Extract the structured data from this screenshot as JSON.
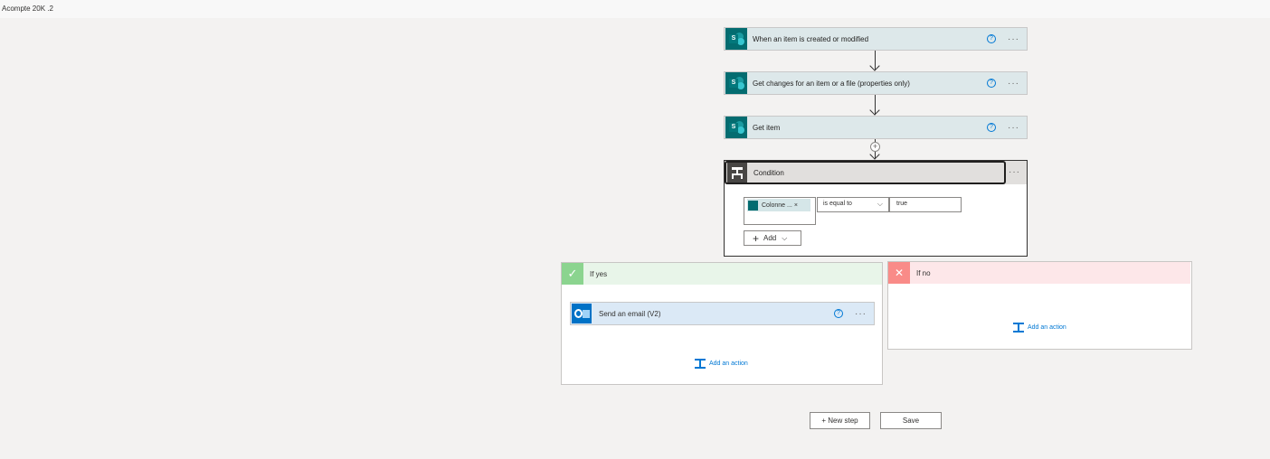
{
  "window": {
    "title": "Acompte 20K .2"
  },
  "steps": [
    {
      "title": "When an item is created or modified",
      "icon": "sharepoint-icon"
    },
    {
      "title": "Get changes for an item or a file (properties only)",
      "icon": "sharepoint-icon"
    },
    {
      "title": "Get item",
      "icon": "sharepoint-icon"
    }
  ],
  "icons": {
    "help": "?",
    "more": "···",
    "plus": "+",
    "check": "✓",
    "cross": "✕",
    "chevron": "⌵",
    "remove": "×",
    "sp_letter": "S"
  },
  "condition": {
    "title": "Condition",
    "token_label": "Colonne ...",
    "operator": "is equal to",
    "value": "true",
    "add_label": "Add"
  },
  "branches": {
    "yes": {
      "label": "If yes",
      "action_title": "Send an email (V2)",
      "add_action_label": "Add an action"
    },
    "no": {
      "label": "If no",
      "add_action_label": "Add an action"
    }
  },
  "footer": {
    "new_step_label": "+ New step",
    "save_label": "Save"
  },
  "colors": {
    "sharepoint": "#036c70",
    "outlook": "#0072c6",
    "yes": "#8bd48f",
    "no": "#f98b88",
    "link": "#0078d4"
  }
}
